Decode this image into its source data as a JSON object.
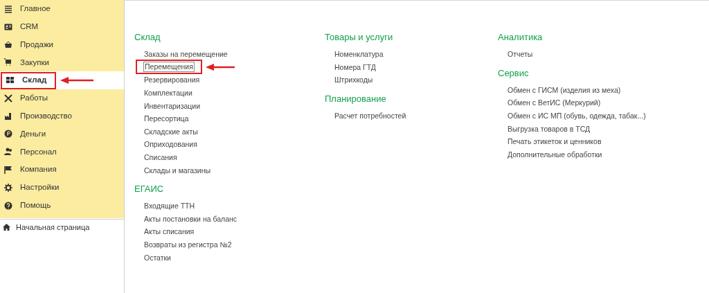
{
  "sidebar": {
    "items": [
      {
        "label": "Главное",
        "selected": false,
        "highlighted": false
      },
      {
        "label": "CRM",
        "selected": false,
        "highlighted": false
      },
      {
        "label": "Продажи",
        "selected": false,
        "highlighted": false
      },
      {
        "label": "Закупки",
        "selected": false,
        "highlighted": false
      },
      {
        "label": "Склад",
        "selected": true,
        "highlighted": true
      },
      {
        "label": "Работы",
        "selected": false,
        "highlighted": false
      },
      {
        "label": "Производство",
        "selected": false,
        "highlighted": false
      },
      {
        "label": "Деньги",
        "selected": false,
        "highlighted": false
      },
      {
        "label": "Персонал",
        "selected": false,
        "highlighted": false
      },
      {
        "label": "Компания",
        "selected": false,
        "highlighted": false
      },
      {
        "label": "Настройки",
        "selected": false,
        "highlighted": false
      },
      {
        "label": "Помощь",
        "selected": false,
        "highlighted": false
      }
    ],
    "home": {
      "label": "Начальная страница"
    }
  },
  "columns": [
    [
      {
        "title": "Склад",
        "items": [
          {
            "label": "Заказы на перемещение",
            "selected": false,
            "highlighted": false
          },
          {
            "label": "Перемещения",
            "selected": true,
            "highlighted": true
          },
          {
            "label": "Резервирования",
            "selected": false,
            "highlighted": false
          },
          {
            "label": "Комплектации",
            "selected": false,
            "highlighted": false
          },
          {
            "label": "Инвентаризации",
            "selected": false,
            "highlighted": false
          },
          {
            "label": "Пересортица",
            "selected": false,
            "highlighted": false
          },
          {
            "label": "Складские акты",
            "selected": false,
            "highlighted": false
          },
          {
            "label": "Оприходования",
            "selected": false,
            "highlighted": false
          },
          {
            "label": "Списания",
            "selected": false,
            "highlighted": false
          },
          {
            "label": "Склады и магазины",
            "selected": false,
            "highlighted": false
          }
        ]
      },
      {
        "title": "ЕГАИС",
        "items": [
          {
            "label": "Входящие ТТН",
            "selected": false,
            "highlighted": false
          },
          {
            "label": "Акты постановки на баланс",
            "selected": false,
            "highlighted": false
          },
          {
            "label": "Акты списания",
            "selected": false,
            "highlighted": false
          },
          {
            "label": "Возвраты из регистра №2",
            "selected": false,
            "highlighted": false
          },
          {
            "label": "Остатки",
            "selected": false,
            "highlighted": false
          }
        ]
      }
    ],
    [
      {
        "title": "Товары и услуги",
        "items": [
          {
            "label": "Номенклатура",
            "selected": false,
            "highlighted": false
          },
          {
            "label": "Номера ГТД",
            "selected": false,
            "highlighted": false
          },
          {
            "label": "Штрихкоды",
            "selected": false,
            "highlighted": false
          }
        ]
      },
      {
        "title": "Планирование",
        "items": [
          {
            "label": "Расчет потребностей",
            "selected": false,
            "highlighted": false
          }
        ]
      }
    ],
    [
      {
        "title": "Аналитика",
        "items": [
          {
            "label": "Отчеты",
            "selected": false,
            "highlighted": false
          }
        ]
      },
      {
        "title": "Сервис",
        "items": [
          {
            "label": "Обмен с ГИСМ (изделия из меха)",
            "selected": false,
            "highlighted": false
          },
          {
            "label": "Обмен с ВетИС (Меркурий)",
            "selected": false,
            "highlighted": false
          },
          {
            "label": "Обмен с ИС МП (обувь, одежда, табак...)",
            "selected": false,
            "highlighted": false
          },
          {
            "label": "Выгрузка товаров в ТСД",
            "selected": false,
            "highlighted": false
          },
          {
            "label": "Печать этикеток и ценников",
            "selected": false,
            "highlighted": false
          },
          {
            "label": "Дополнительные обработки",
            "selected": false,
            "highlighted": false
          }
        ]
      }
    ]
  ]
}
